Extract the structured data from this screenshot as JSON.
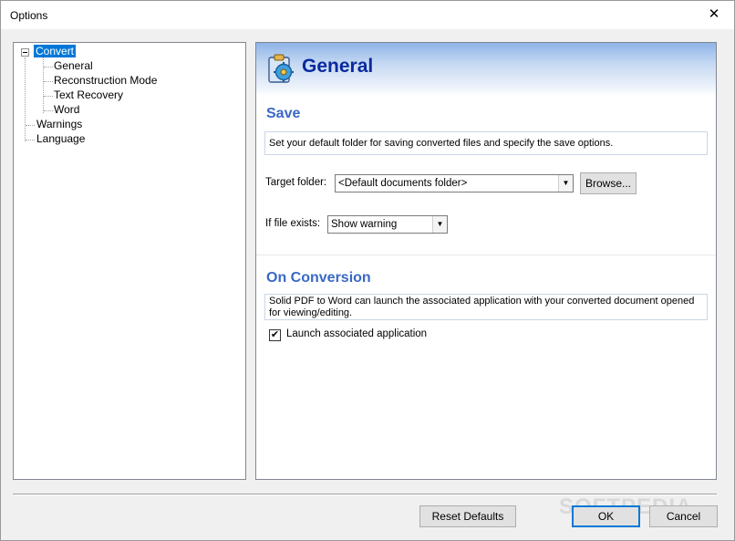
{
  "window": {
    "title": "Options",
    "close_glyph": "✕"
  },
  "tree": {
    "items": [
      {
        "label": "Convert",
        "selected": true,
        "expander": "minus"
      },
      {
        "label": "General"
      },
      {
        "label": "Reconstruction Mode"
      },
      {
        "label": "Text Recovery"
      },
      {
        "label": "Word"
      },
      {
        "label": "Warnings"
      },
      {
        "label": "Language"
      }
    ]
  },
  "panel": {
    "title": "General",
    "icon": "settings-gear-clipboard-icon",
    "save": {
      "title": "Save",
      "description": "Set your default folder for saving converted files and specify the save options.",
      "target_folder_label": "Target folder:",
      "target_folder_value": "<Default documents folder>",
      "browse_label": "Browse...",
      "if_exists_label": "If file exists:",
      "if_exists_value": "Show warning"
    },
    "conversion": {
      "title": "On Conversion",
      "description": "Solid PDF to Word can launch the associated application with your converted document opened for viewing/editing.",
      "launch_label": "Launch associated application",
      "launch_checked": true
    }
  },
  "footer": {
    "reset_label": "Reset Defaults",
    "ok_label": "OK",
    "cancel_label": "Cancel"
  },
  "watermark": "SOFTPEDIA",
  "colors": {
    "selection": "#0078d7",
    "header_title": "#0a2a9e",
    "section_title": "#3968c6"
  }
}
